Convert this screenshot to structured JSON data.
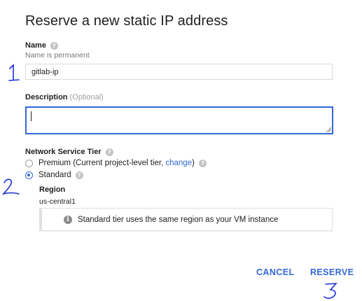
{
  "dialog": {
    "title": "Reserve a new static IP address"
  },
  "name_field": {
    "label": "Name",
    "hint": "Name is permanent",
    "value": "gitlab-ip"
  },
  "description_field": {
    "label": "Description",
    "optional": "(Optional)",
    "value": ""
  },
  "tier": {
    "label": "Network Service Tier",
    "premium_label": "Premium (Current project-level tier,",
    "change_link": "change",
    "premium_suffix": ")",
    "standard_label": "Standard",
    "selected": "Standard"
  },
  "region": {
    "label": "Region",
    "value": "us-central1"
  },
  "info": {
    "text": "Standard tier uses the same region as your VM instance"
  },
  "actions": {
    "cancel": "CANCEL",
    "reserve": "RESERVE"
  },
  "annotations": {
    "one": "1",
    "two": "2",
    "three": "3"
  },
  "colors": {
    "accent": "#3367d6",
    "annotation_ink": "#1a2fd6"
  }
}
